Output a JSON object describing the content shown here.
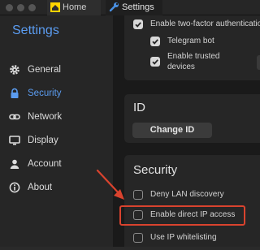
{
  "window": {
    "tabs": [
      {
        "label": "Home",
        "icon": "home-icon"
      },
      {
        "label": "Settings",
        "icon": "wrench-icon"
      }
    ]
  },
  "sidebar": {
    "title": "Settings",
    "items": [
      {
        "label": "General",
        "icon": "gear-icon",
        "active": false
      },
      {
        "label": "Security",
        "icon": "lock-icon",
        "active": true
      },
      {
        "label": "Network",
        "icon": "link-icon",
        "active": false
      },
      {
        "label": "Display",
        "icon": "monitor-icon",
        "active": false
      },
      {
        "label": "Account",
        "icon": "person-icon",
        "active": false
      },
      {
        "label": "About",
        "icon": "info-icon",
        "active": false
      }
    ]
  },
  "twofa": {
    "enable_label": "Enable two-factor authenticatio",
    "enable_checked": true,
    "telegram_label": "Telegram bot",
    "telegram_checked": true,
    "trusted_label_line1": "Enable trusted",
    "trusted_label_line2": "devices",
    "trusted_checked": true
  },
  "id_section": {
    "title": "ID",
    "button_label": "Change ID"
  },
  "security_section": {
    "title": "Security",
    "options": [
      {
        "label": "Deny LAN discovery",
        "checked": false
      },
      {
        "label": "Enable direct IP access",
        "checked": false,
        "highlighted": true
      },
      {
        "label": "Use IP whitelisting",
        "checked": false
      }
    ]
  },
  "colors": {
    "accent": "#5b9cf0",
    "highlight_box": "#d9432e",
    "annotation_arrow": "#d9432e",
    "sidebar_bg": "#262626",
    "content_bg": "#1a1a1a"
  }
}
